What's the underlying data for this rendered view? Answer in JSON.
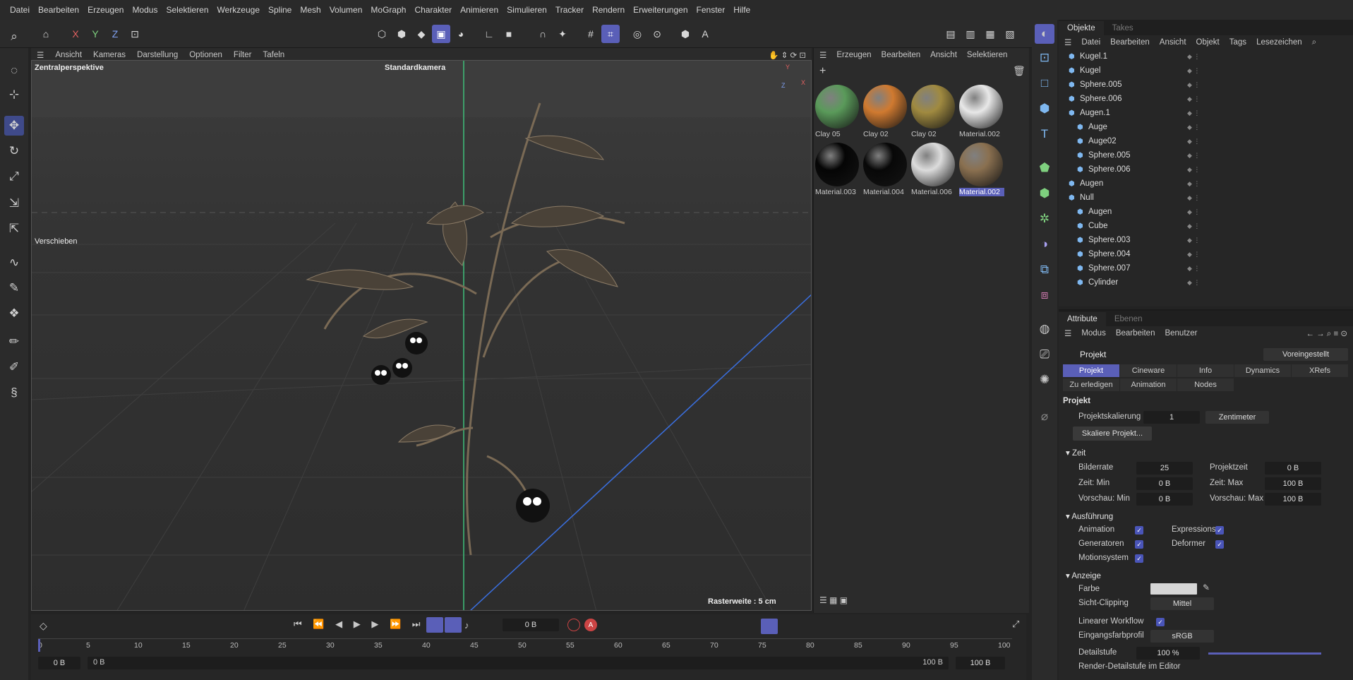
{
  "menu": [
    "Datei",
    "Bearbeiten",
    "Erzeugen",
    "Modus",
    "Selektieren",
    "Werkzeuge",
    "Spline",
    "Mesh",
    "Volumen",
    "MoGraph",
    "Charakter",
    "Animieren",
    "Simulieren",
    "Tracker",
    "Rendern",
    "Erweiterungen",
    "Fenster",
    "Hilfe"
  ],
  "toolbar": {
    "x": "X",
    "y": "Y",
    "z": "Z"
  },
  "viewport": {
    "menu": [
      "Ansicht",
      "Kameras",
      "Darstellung",
      "Optionen",
      "Filter",
      "Tafeln"
    ],
    "perspective": "Zentralperspektive",
    "camera": "Standardkamera",
    "tool_label": "Verschieben",
    "grid_info": "Rasterweite : 5 cm",
    "axis_x": "X",
    "axis_y": "Y",
    "axis_z": "Z"
  },
  "material_manager": {
    "menu": [
      "Erzeugen",
      "Bearbeiten",
      "Ansicht",
      "Selektieren"
    ],
    "materials": [
      {
        "name": "Clay 05",
        "color": "#5a9a5a"
      },
      {
        "name": "Clay 02",
        "color": "#d07a30"
      },
      {
        "name": "Clay 02",
        "color": "#a08a40"
      },
      {
        "name": "Material.002",
        "color": "#e8e8e8"
      },
      {
        "name": "Material.003",
        "color": "#050505"
      },
      {
        "name": "Material.004",
        "color": "#080808"
      },
      {
        "name": "Material.006",
        "color": "#dcdcdc"
      },
      {
        "name": "Material.002",
        "color": "#8a7050"
      }
    ]
  },
  "objects_panel": {
    "tabs": [
      "Objekte",
      "Takes"
    ],
    "menu": [
      "Datei",
      "Bearbeiten",
      "Ansicht",
      "Objekt",
      "Tags",
      "Lesezeichen"
    ],
    "rows": [
      {
        "name": "Kugel.1",
        "indent": 0
      },
      {
        "name": "Kugel",
        "indent": 0
      },
      {
        "name": "Sphere.005",
        "indent": 0
      },
      {
        "name": "Sphere.006",
        "indent": 0
      },
      {
        "name": "Augen.1",
        "indent": 0
      },
      {
        "name": "Auge",
        "indent": 1
      },
      {
        "name": "Auge02",
        "indent": 1
      },
      {
        "name": "Sphere.005",
        "indent": 1
      },
      {
        "name": "Sphere.006",
        "indent": 1
      },
      {
        "name": "Augen",
        "indent": 0
      },
      {
        "name": "Null",
        "indent": 0
      },
      {
        "name": "Augen",
        "indent": 1
      },
      {
        "name": "Cube",
        "indent": 1
      },
      {
        "name": "Sphere.003",
        "indent": 1
      },
      {
        "name": "Sphere.004",
        "indent": 1
      },
      {
        "name": "Sphere.007",
        "indent": 1
      },
      {
        "name": "Cylinder",
        "indent": 1
      }
    ]
  },
  "attr_panel": {
    "tabs": [
      "Attribute",
      "Ebenen"
    ],
    "menu": [
      "Modus",
      "Bearbeiten",
      "Benutzer"
    ],
    "title": "Projekt",
    "preset": "Voreingestellt",
    "ptabs": [
      "Projekt",
      "Cineware",
      "Info",
      "Dynamics",
      "XRefs"
    ],
    "ptabs2": [
      "Zu erledigen",
      "Animation",
      "Nodes"
    ],
    "section": "Projekt",
    "scale_label": "Projektskalierung",
    "scale_value": "1",
    "scale_unit": "Zentimeter",
    "scale_button": "Skaliere Projekt...",
    "zeit": "Zeit",
    "bilderrate": "Bilderrate",
    "bilderrate_v": "25",
    "projektzeit": "Projektzeit",
    "projektzeit_v": "0 B",
    "zeitmin": "Zeit: Min",
    "zeitmin_v": "0 B",
    "zeitmax": "Zeit: Max",
    "zeitmax_v": "100 B",
    "vormin": "Vorschau: Min",
    "vormin_v": "0 B",
    "vormax": "Vorschau: Max",
    "vormax_v": "100 B",
    "ausfuehrung": "Ausführung",
    "animation": "Animation",
    "expressions": "Expressions",
    "generatoren": "Generatoren",
    "deformer": "Deformer",
    "motionsystem": "Motionsystem",
    "anzeige": "Anzeige",
    "farbe": "Farbe",
    "sicht": "Sicht-Clipping",
    "sicht_v": "Mittel",
    "linear": "Linearer Workflow",
    "eingang": "Eingangsfarbprofil",
    "eingang_v": "sRGB",
    "detail": "Detailstufe",
    "detail_v": "100 %",
    "render_detail": "Render-Detailstufe im Editor"
  },
  "timeline": {
    "frame": "0 B",
    "ticks": [
      "0",
      "5",
      "10",
      "15",
      "20",
      "25",
      "30",
      "35",
      "40",
      "45",
      "50",
      "55",
      "60",
      "65",
      "70",
      "75",
      "80",
      "85",
      "90",
      "95",
      "100"
    ],
    "start": "0 B",
    "range_start": "0 B",
    "range_end": "100 B",
    "end": "100 B"
  },
  "colors": {
    "accent": "#5a5fb8",
    "bg": "#232323"
  }
}
